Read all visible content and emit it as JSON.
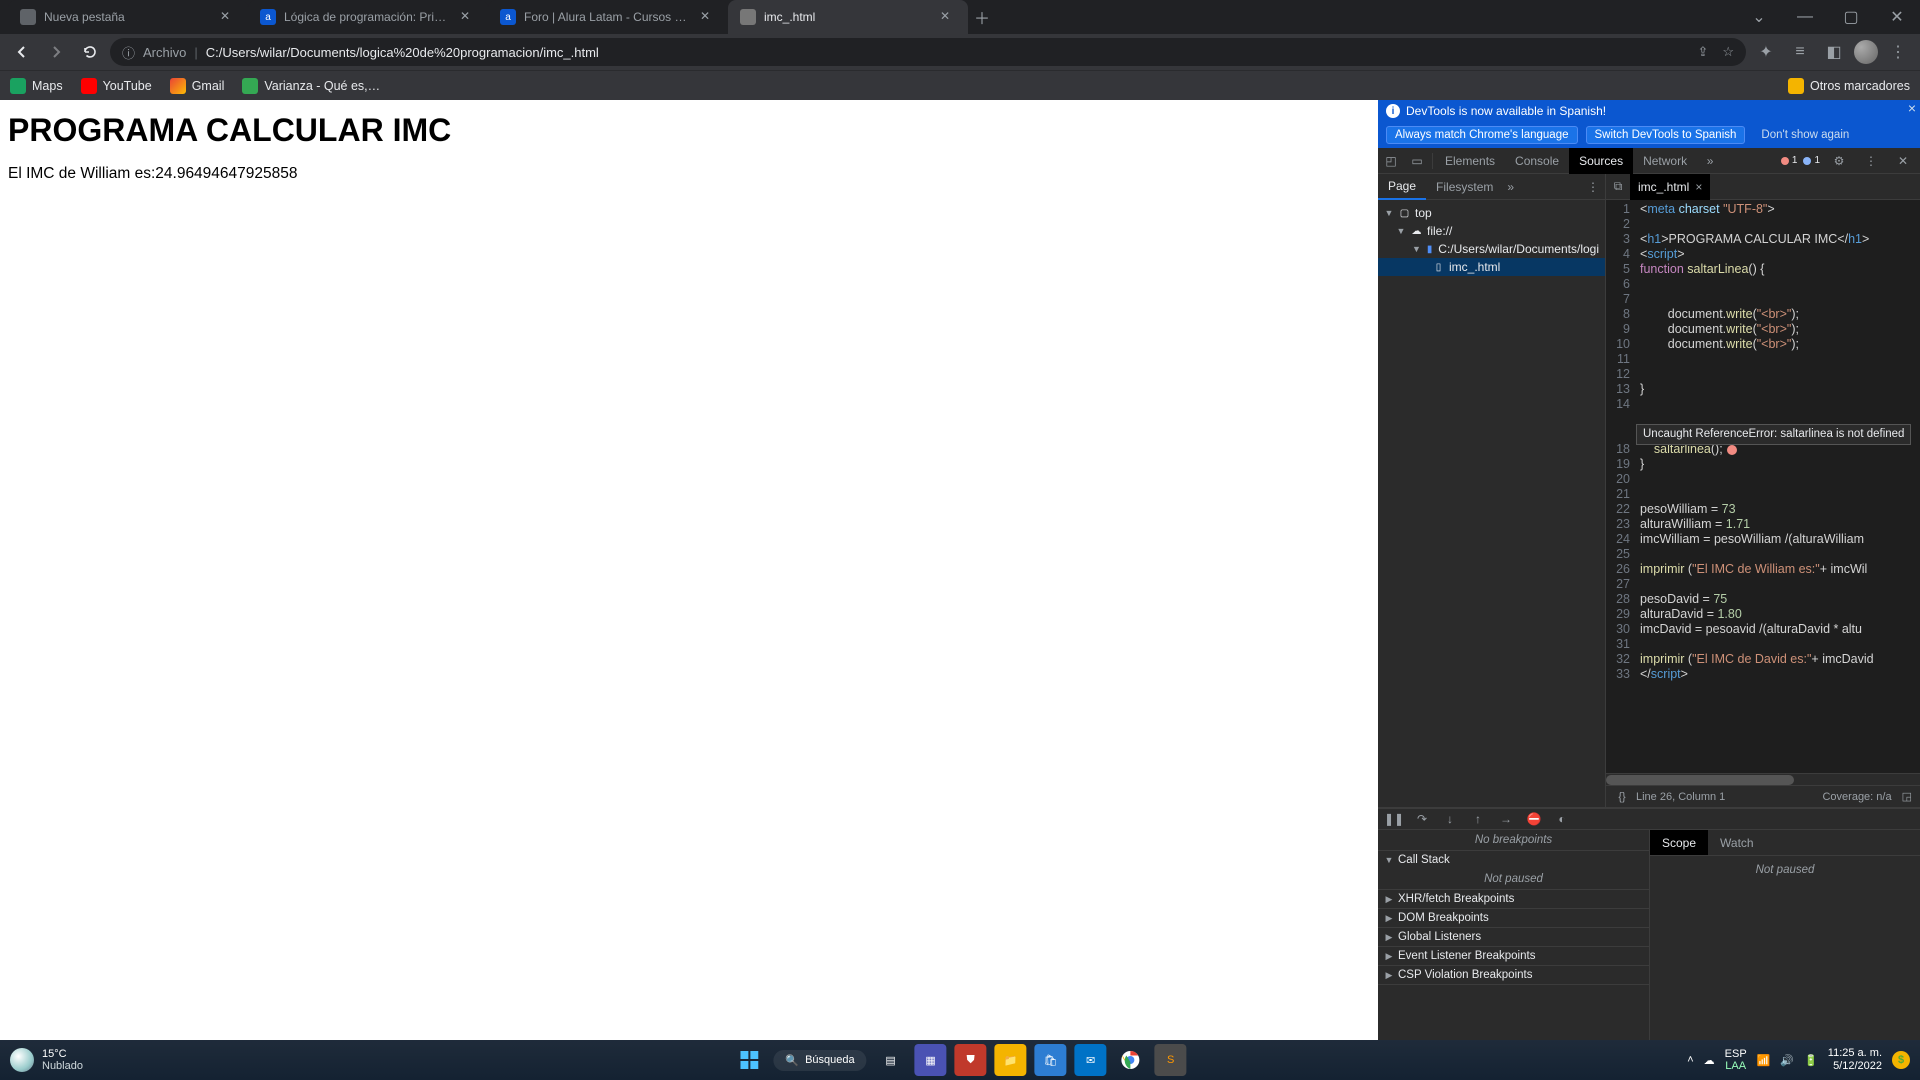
{
  "tabs": [
    {
      "label": "Nueva pestaña",
      "favicon": "#5f6368"
    },
    {
      "label": "Lógica de programación: Primero",
      "favicon": "#0b57d0"
    },
    {
      "label": "Foro | Alura Latam - Cursos onlin",
      "favicon": "#0b57d0"
    },
    {
      "label": "imc_.html",
      "favicon": "#777",
      "active": true
    }
  ],
  "omnibox": {
    "prefix": "Archivo",
    "url": "C:/Users/wilar/Documents/logica%20de%20programacion/imc_.html"
  },
  "bookmarks": [
    {
      "label": "Maps",
      "color": "#1aa260"
    },
    {
      "label": "YouTube",
      "color": "#ff0000"
    },
    {
      "label": "Gmail",
      "color": "#ea4335"
    },
    {
      "label": "Varianza - Qué es,…",
      "color": "#34a853"
    }
  ],
  "other_bookmarks": "Otros marcadores",
  "page": {
    "h1": "PROGRAMA CALCULAR IMC",
    "p": "El IMC de William es:24.96494647925858"
  },
  "devtools": {
    "banner1": "DevTools is now available in Spanish!",
    "banner2": {
      "a": "Always match Chrome's language",
      "b": "Switch DevTools to Spanish",
      "c": "Don't show again"
    },
    "tabs": [
      "Elements",
      "Console",
      "Sources",
      "Network"
    ],
    "active_tab": "Sources",
    "err_count": "1",
    "info_count": "1",
    "nav_tabs": [
      "Page",
      "Filesystem"
    ],
    "tree": {
      "top": "top",
      "file": "file://",
      "path": "C:/Users/wilar/Documents/logi",
      "leaf": "imc_.html"
    },
    "editor_tab": "imc_.html",
    "lines": [
      "1",
      "2",
      "3",
      "4",
      "5",
      "6",
      "7",
      "8",
      "9",
      "10",
      "11",
      "12",
      "13",
      "14",
      "",
      "",
      "18",
      "19",
      "20",
      "21",
      "22",
      "23",
      "24",
      "25",
      "26",
      "27",
      "28",
      "29",
      "30",
      "31",
      "32",
      "33"
    ],
    "error_tooltip": "Uncaught ReferenceError: saltarlinea is not defined",
    "cursor": "Line 26, Column 1",
    "coverage": "Coverage: n/a",
    "accordion": {
      "breakpoints_body": "No breakpoints",
      "callstack": "Call Stack",
      "callstack_body": "Not paused",
      "xhr": "XHR/fetch Breakpoints",
      "dom": "DOM Breakpoints",
      "global": "Global Listeners",
      "event": "Event Listener Breakpoints",
      "csp": "CSP Violation Breakpoints"
    },
    "watch": {
      "tabs": [
        "Scope",
        "Watch"
      ],
      "body": "Not paused"
    }
  },
  "taskbar": {
    "temp": "15°C",
    "cond": "Nublado",
    "search": "Búsqueda",
    "lang1": "ESP",
    "lang2": "LAA",
    "time": "11:25 a. m.",
    "date": "5/12/2022"
  }
}
